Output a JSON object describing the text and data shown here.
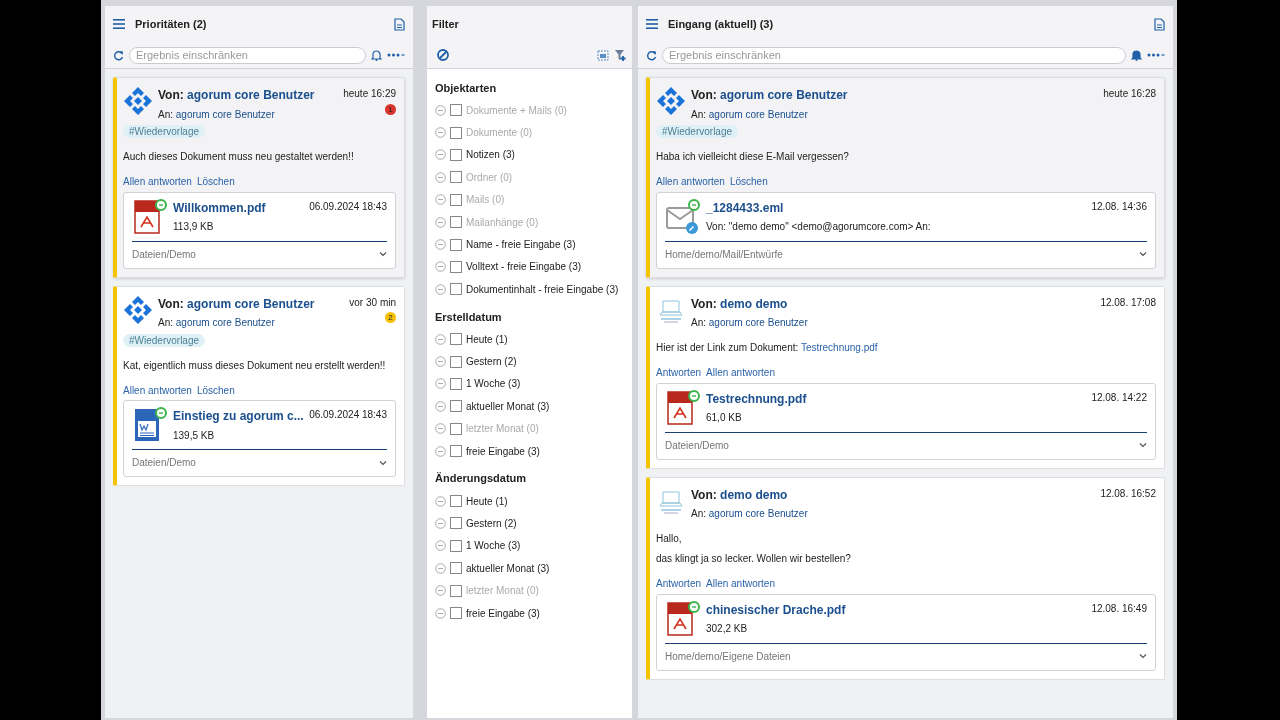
{
  "panels": [
    {
      "kind": "list",
      "title": "Prioritäten (2)",
      "placeholder": "Ergebnis einschränken",
      "notify": false,
      "cards": [
        {
          "selected": true,
          "avatar": {
            "kind": "logo"
          },
          "from_label": "Von:",
          "from": "agorum core Benutzer",
          "to_label": "An:",
          "to": "agorum core Benutzer",
          "time": "heute 16:29",
          "badge": {
            "text": "1",
            "color": "#d9342b"
          },
          "tag": "#Wiedervorlage",
          "body": [
            {
              "text": "Auch dieses Dokument muss neu gestaltet werden!!"
            }
          ],
          "actions": [
            "Allen antworten",
            "Löschen"
          ],
          "attachment": {
            "kind": "pdf",
            "name": "Willkommen.pdf",
            "date": "06.09.2024 18:43",
            "detail": "113,9 KB",
            "path": "Dateien/Demo"
          }
        },
        {
          "selected": false,
          "avatar": {
            "kind": "logo"
          },
          "from_label": "Von:",
          "from": "agorum core Benutzer",
          "to_label": "An:",
          "to": "agorum core Benutzer",
          "time": "vor 30 min",
          "badge": {
            "text": "2",
            "color": "#f5c000"
          },
          "tag": "#Wiedervorlage",
          "body": [
            {
              "text": "Kat, eigentlich muss dieses Dokument neu erstellt werden!!"
            }
          ],
          "actions": [
            "Allen antworten",
            "Löschen"
          ],
          "attachment": {
            "kind": "doc",
            "name": "Einstieg zu agorum c...",
            "date": "06.09.2024 18:43",
            "detail": "139,5 KB",
            "path": "Dateien/Demo"
          }
        }
      ]
    },
    {
      "kind": "filter",
      "title": "Filter",
      "groups": [
        {
          "title": "Objektarten",
          "items": [
            {
              "label": "Dokumente + Mails (0)",
              "disabled": true,
              "checked": false
            },
            {
              "label": "Dokumente (0)",
              "disabled": true,
              "checked": false
            },
            {
              "label": "Notizen (3)",
              "disabled": false,
              "checked": false
            },
            {
              "label": "Ordner (0)",
              "disabled": true,
              "checked": false
            },
            {
              "label": "Mails (0)",
              "disabled": true,
              "checked": false
            },
            {
              "label": "Mailanhänge (0)",
              "disabled": true,
              "checked": false
            },
            {
              "label": "Name - freie Eingabe (3)",
              "disabled": false,
              "checked": false
            },
            {
              "label": "Volltext - freie Eingabe (3)",
              "disabled": false,
              "checked": false
            },
            {
              "label": "Dokumentinhalt - freie Eingabe (3)",
              "disabled": false,
              "checked": false
            }
          ]
        },
        {
          "title": "Erstelldatum",
          "items": [
            {
              "label": "Heute (1)",
              "disabled": false,
              "checked": false
            },
            {
              "label": "Gestern (2)",
              "disabled": false,
              "checked": false
            },
            {
              "label": "1 Woche (3)",
              "disabled": false,
              "checked": false
            },
            {
              "label": "aktueller Monat (3)",
              "disabled": false,
              "checked": false
            },
            {
              "label": "letzter Monat (0)",
              "disabled": true,
              "checked": false
            },
            {
              "label": "freie Eingabe (3)",
              "disabled": false,
              "checked": false
            }
          ]
        },
        {
          "title": "Änderungsdatum",
          "items": [
            {
              "label": "Heute (1)",
              "disabled": false,
              "checked": false
            },
            {
              "label": "Gestern (2)",
              "disabled": false,
              "checked": false
            },
            {
              "label": "1 Woche (3)",
              "disabled": false,
              "checked": false
            },
            {
              "label": "aktueller Monat (3)",
              "disabled": false,
              "checked": false
            },
            {
              "label": "letzter Monat (0)",
              "disabled": true,
              "checked": false
            },
            {
              "label": "freie Eingabe (3)",
              "disabled": false,
              "checked": false
            }
          ]
        }
      ]
    },
    {
      "kind": "list",
      "title": "Eingang (aktuell) (3)",
      "placeholder": "Ergebnis einschränken",
      "notify": true,
      "cards": [
        {
          "selected": true,
          "avatar": {
            "kind": "logo"
          },
          "from_label": "Von:",
          "from": "agorum core Benutzer",
          "to_label": "An:",
          "to": "agorum core Benutzer",
          "time": "heute 16:28",
          "tag": "#Wiedervorlage",
          "body": [
            {
              "text": "Haba ich vielleicht diese E-Mail vergessen?"
            }
          ],
          "actions": [
            "Allen antworten",
            "Löschen"
          ],
          "attachment": {
            "kind": "eml",
            "name": "_1284433.eml",
            "date": "12.08. 14:36",
            "detail": "Von: \"demo demo\" <demo@agorumcore.com>  An:",
            "path": "Home/demo/Mail/Entwürfe"
          }
        },
        {
          "selected": false,
          "avatar": {
            "kind": "company"
          },
          "from_label": "Von:",
          "from": "demo demo",
          "to_label": "An:",
          "to": "agorum core Benutzer",
          "time": "12.08. 17:08",
          "body": [
            {
              "text": "Hier ist der Link zum Dokument:",
              "link": "Testrechnung.pdf"
            }
          ],
          "actions": [
            "Antworten",
            "Allen antworten"
          ],
          "attachment": {
            "kind": "pdf",
            "name": "Testrechnung.pdf",
            "date": "12.08. 14:22",
            "detail": "61,0 KB",
            "path": "Dateien/Demo"
          }
        },
        {
          "selected": false,
          "avatar": {
            "kind": "company"
          },
          "from_label": "Von:",
          "from": "demo demo",
          "to_label": "An:",
          "to": "agorum core Benutzer",
          "time": "12.08. 16:52",
          "body": [
            {
              "text": "Hallo,"
            },
            {
              "text": "das klingt ja so lecker. Wollen wir bestellen?"
            }
          ],
          "actions": [
            "Antworten",
            "Allen antworten"
          ],
          "attachment": {
            "kind": "pdf",
            "name": "chinesischer Drache.pdf",
            "date": "12.08. 16:49",
            "detail": "302,2 KB",
            "path": "Home/demo/Eigene Dateien"
          }
        }
      ]
    }
  ]
}
